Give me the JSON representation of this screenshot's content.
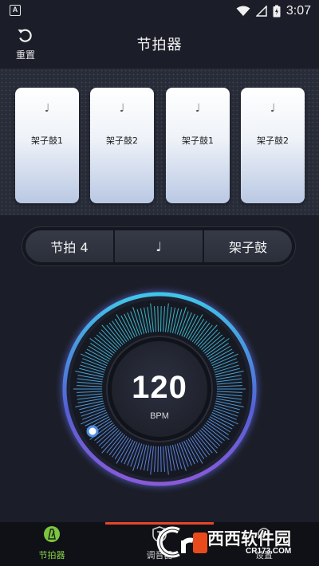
{
  "status_bar": {
    "app_badge": "A",
    "time": "3:07"
  },
  "header": {
    "reset_label": "重置",
    "title": "节拍器"
  },
  "pads": [
    {
      "note": "♩",
      "label": "架子鼓1"
    },
    {
      "note": "♩",
      "label": "架子鼓2"
    },
    {
      "note": "♩",
      "label": "架子鼓1"
    },
    {
      "note": "♩",
      "label": "架子鼓2"
    }
  ],
  "controls": {
    "beat": "节拍 4",
    "note": "♩",
    "sound": "架子鼓"
  },
  "dial": {
    "bpm": "120",
    "unit": "BPM"
  },
  "bottom_nav": {
    "items": [
      {
        "label": "节拍器",
        "icon": "metronome-icon",
        "active": true
      },
      {
        "label": "调音器",
        "icon": "tuner-icon",
        "active": false
      },
      {
        "label": "设置",
        "icon": "settings-icon",
        "active": false
      }
    ]
  },
  "watermark": {
    "text": "西西软件园",
    "url": "CR173.COM"
  },
  "colors": {
    "background": "#1b1e28",
    "pad_panel": "#282c38",
    "active_nav": "#8bd349",
    "dial_ring": "#5aa8d8",
    "accent": "#e8452a"
  }
}
